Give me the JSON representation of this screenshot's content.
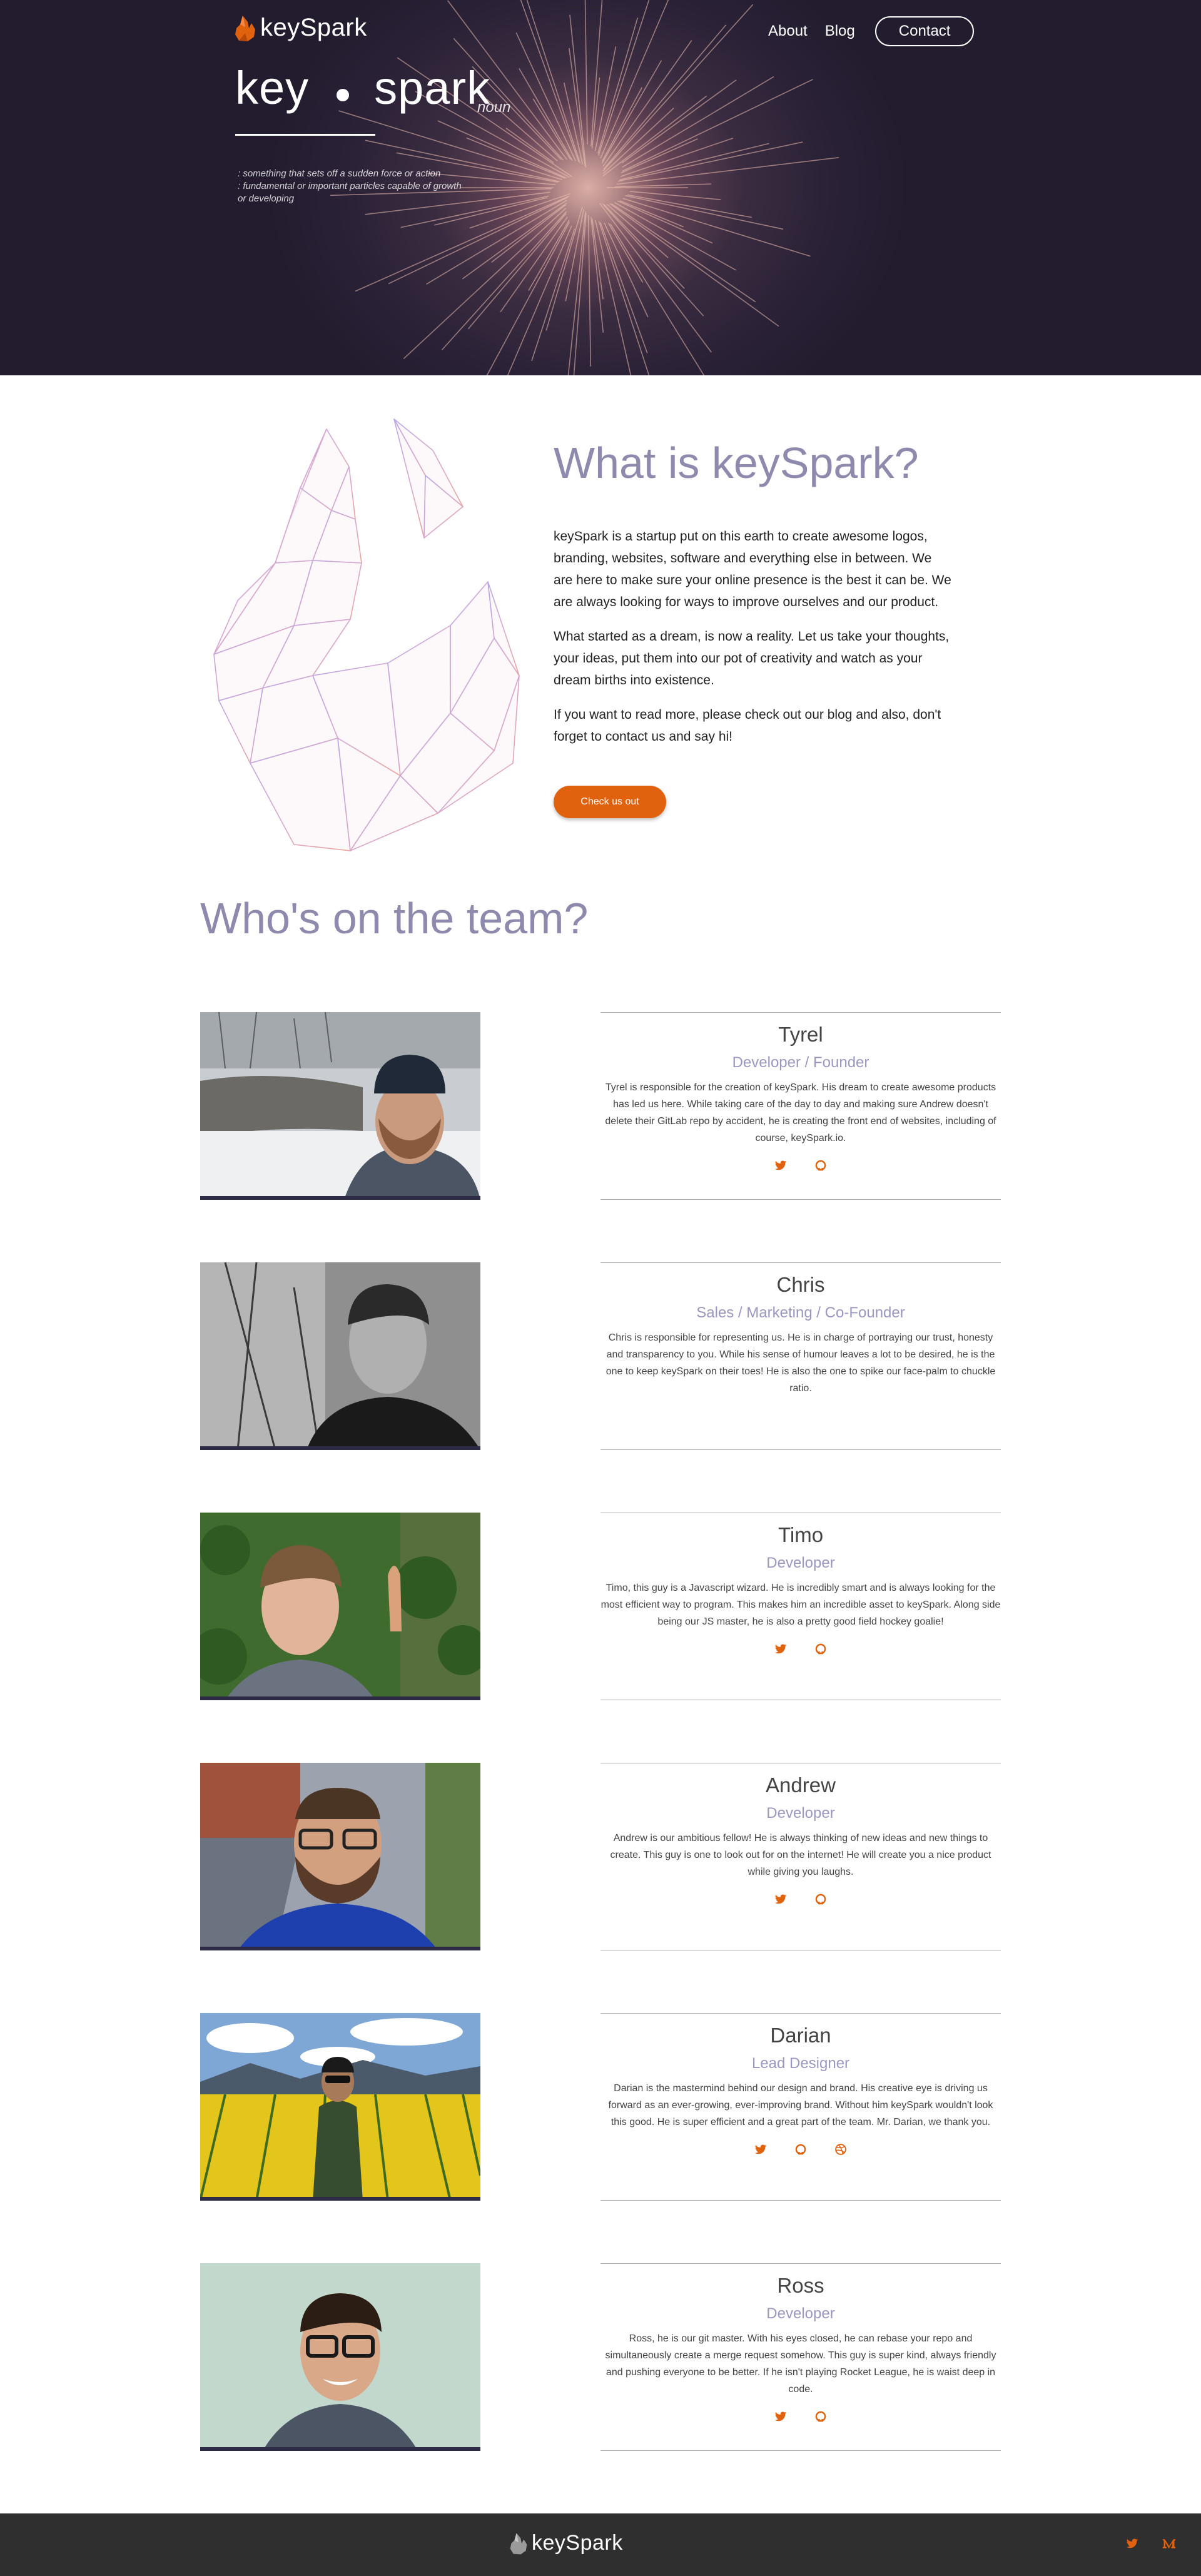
{
  "header": {
    "logo_text": "keySpark",
    "nav": {
      "about": "About",
      "blog": "Blog",
      "contact": "Contact"
    }
  },
  "hero": {
    "word_left": "key",
    "word_right": "spark",
    "part_of_speech": "noun",
    "definition_1": ": something that sets off a sudden force or action",
    "definition_2": ": fundamental or important particles capable of growth or developing"
  },
  "about": {
    "title": "What is keySpark?",
    "paragraphs": [
      "keySpark is a startup put on this earth to create awesome logos, branding, websites, software and everything else in between. We are here to make sure your online presence is the best it can be. We are always looking for ways to improve ourselves and our product.",
      "What started as a dream, is now a reality. Let us take your thoughts, your ideas, put them into our pot of creativity and watch as your dream births into existence.",
      "If you want to read more, please check out our blog and also, don't forget to contact us and say hi!"
    ],
    "cta_label": "Check us out"
  },
  "team": {
    "title": "Who's on the team?",
    "members": [
      {
        "name": "Tyrel",
        "role": "Developer / Founder",
        "bio": "Tyrel is responsible for the creation of keySpark. His dream to create awesome products has led us here. While taking care of the day to day and making sure Andrew doesn't delete their GitLab repo by accident, he is creating the front end of websites, including of course, keySpark.io.",
        "icons": [
          "twitter-icon",
          "github-icon"
        ]
      },
      {
        "name": "Chris",
        "role": "Sales / Marketing / Co-Founder",
        "bio": "Chris is responsible for representing us. He is in charge of portraying our trust, honesty and transparency to you. While his sense of humour leaves a lot to be desired, he is the one to keep keySpark on their toes! He is also the one to spike our face-palm to chuckle ratio.",
        "icons": []
      },
      {
        "name": "Timo",
        "role": "Developer",
        "bio": "Timo, this guy is a Javascript wizard. He is incredibly smart and is always looking for the most efficient way to program. This makes him an incredible asset to keySpark. Along side being our JS master, he is also a pretty good field hockey goalie!",
        "icons": [
          "twitter-icon",
          "github-icon"
        ]
      },
      {
        "name": "Andrew",
        "role": "Developer",
        "bio": "Andrew is our ambitious fellow! He is always thinking of new ideas and new things to create. This guy is one to look out for on the internet! He will create you a nice product while giving you laughs.",
        "icons": [
          "twitter-icon",
          "github-icon"
        ]
      },
      {
        "name": "Darian",
        "role": "Lead Designer",
        "bio": "Darian is the mastermind behind our design and brand. His creative eye is driving us forward as an ever-growing, ever-improving brand. Without him keySpark wouldn't look this good. He is super efficient and a great part of the team. Mr. Darian, we thank you.",
        "icons": [
          "twitter-icon",
          "github-icon",
          "dribbble-icon"
        ]
      },
      {
        "name": "Ross",
        "role": "Developer",
        "bio": "Ross, he is our git master. With his eyes closed, he can rebase your repo and simultaneously create a merge request somehow. This guy is super kind, always friendly and pushing everyone to be better. If he isn't playing Rocket League, he is waist deep in code.",
        "icons": [
          "twitter-icon",
          "github-icon"
        ]
      }
    ]
  },
  "footer": {
    "logo_text": "keySpark",
    "icons": [
      "twitter-icon",
      "medium-icon"
    ]
  },
  "colors": {
    "accent": "#e0620f",
    "heading": "#8e8aae",
    "role": "#9b98c0",
    "hero_bg": "#2a2136",
    "footer_bg": "#2f2f2f"
  }
}
